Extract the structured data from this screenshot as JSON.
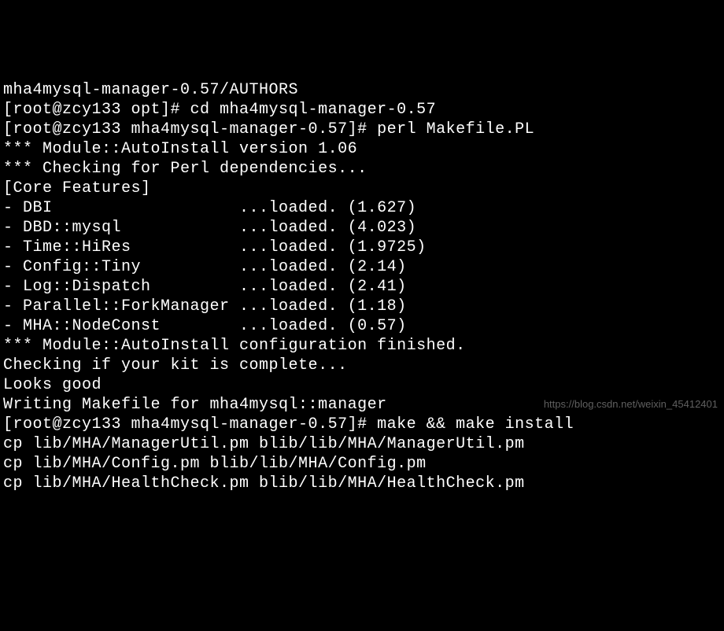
{
  "terminal": {
    "lines": [
      "mha4mysql-manager-0.57/AUTHORS",
      "[root@zcy133 opt]# cd mha4mysql-manager-0.57",
      "[root@zcy133 mha4mysql-manager-0.57]# perl Makefile.PL",
      "*** Module::AutoInstall version 1.06",
      "*** Checking for Perl dependencies...",
      "[Core Features]",
      "- DBI                   ...loaded. (1.627)",
      "- DBD::mysql            ...loaded. (4.023)",
      "- Time::HiRes           ...loaded. (1.9725)",
      "- Config::Tiny          ...loaded. (2.14)",
      "- Log::Dispatch         ...loaded. (2.41)",
      "- Parallel::ForkManager ...loaded. (1.18)",
      "- MHA::NodeConst        ...loaded. (0.57)",
      "*** Module::AutoInstall configuration finished.",
      "Checking if your kit is complete...",
      "Looks good",
      "Writing Makefile for mha4mysql::manager",
      "[root@zcy133 mha4mysql-manager-0.57]# make && make install",
      "cp lib/MHA/ManagerUtil.pm blib/lib/MHA/ManagerUtil.pm",
      "cp lib/MHA/Config.pm blib/lib/MHA/Config.pm",
      "cp lib/MHA/HealthCheck.pm blib/lib/MHA/HealthCheck.pm"
    ]
  },
  "watermark": "https://blog.csdn.net/weixin_45412401"
}
